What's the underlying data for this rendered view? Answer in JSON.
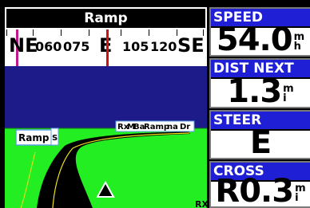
{
  "title": "Ramp",
  "compass": {
    "left_cardinal": "NE",
    "center_cardinal": "E",
    "right_cardinal": "SE",
    "left_nums": [
      "060",
      "075"
    ],
    "right_nums": [
      "105",
      "120"
    ]
  },
  "scene": {
    "waypoint_label": "Ramp",
    "waypoint_suffix": "S",
    "far_labels": [
      "Rx",
      "M",
      "Ba",
      "Ramp",
      "na",
      "Dr"
    ],
    "corner_label": "RX"
  },
  "fields": [
    {
      "label": "SPEED",
      "value": "54.0",
      "unit_top": "m",
      "unit_bottom": "h"
    },
    {
      "label": "DIST NEXT",
      "value": "1.3",
      "unit_top": "m",
      "unit_bottom": "i"
    },
    {
      "label": "STEER",
      "value": "E",
      "unit_top": "",
      "unit_bottom": ""
    },
    {
      "label": "CROSS TRACK",
      "value": "R0.3",
      "unit_top": "m",
      "unit_bottom": "i"
    }
  ],
  "colors": {
    "sky": "#1d1a8a",
    "ground": "#22ee22",
    "road": "#000000",
    "field_header": "#1f1fd6",
    "course_marker": "#c0188a",
    "heading_marker": "#d01010"
  }
}
